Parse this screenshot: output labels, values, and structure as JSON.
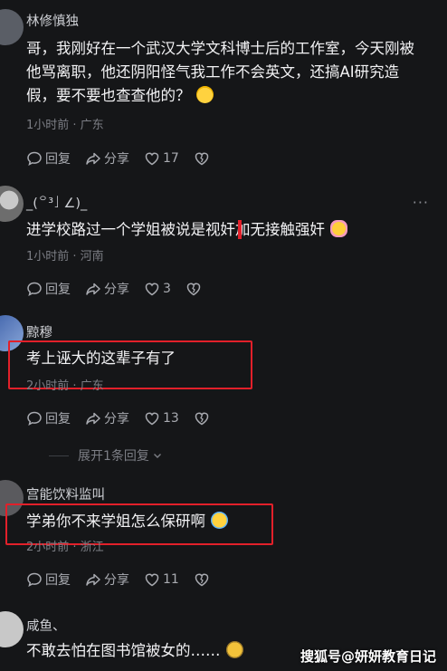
{
  "comments": [
    {
      "name": "林修慎独",
      "text": "哥，我刚好在一个武汉大学文科博士后的工作室，今天刚被他骂离职，他还阴阳怪气我工作不会英文，还搞AI研究造假，要不要也查查他的？",
      "emoji": "laughing-sweat-emoji",
      "meta": "1小时前 · 广东",
      "reply_label": "回复",
      "share_label": "分享",
      "likes": "17"
    },
    {
      "name": "_(꒪³」∠)_",
      "text": "进学校路过一个学姐被说是视奸加无接触强奸",
      "emoji": "hug-emoji",
      "meta": "1小时前 · 河南",
      "reply_label": "回复",
      "share_label": "分享",
      "likes": "3",
      "more": "···"
    },
    {
      "name": "黥穆",
      "text": "考上诬大的这辈子有了",
      "meta": "2小时前 · 广东",
      "reply_label": "回复",
      "share_label": "分享",
      "likes": "13"
    },
    {
      "name": "宫能饮料监叫",
      "text": "学弟你不来学姐怎么保研啊",
      "emoji": "crying-emoji",
      "meta": "2小时前 · 浙江",
      "reply_label": "回复",
      "share_label": "分享",
      "likes": "11"
    },
    {
      "name": "咸鱼、",
      "text": "不敢去怕在图书馆被女的……",
      "emoji": "sweat-emoji"
    }
  ],
  "expand_replies": "展开1条回复",
  "watermark": "搜狐号@妍妍教育日记",
  "colors": {
    "highlight": "#e2202a",
    "background": "#151618"
  }
}
